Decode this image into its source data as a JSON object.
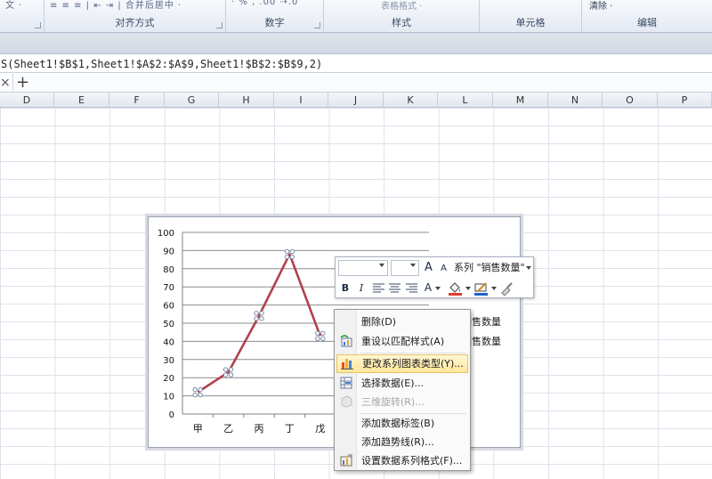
{
  "ribbon": {
    "groups": [
      {
        "label": "对齐方式"
      },
      {
        "label": "数字"
      },
      {
        "label": "样式",
        "sub": "表格格式 ·"
      },
      {
        "label": "单元格"
      },
      {
        "label": "编辑",
        "sub": "清除 ·"
      }
    ],
    "left_glyph": "文 ·",
    "align_glyphs": "≡ ≡ ≡ | ⇤ ⇥ | 合并后居中 ·",
    "number_glyphs": "· % ,  .00 ⇢.0"
  },
  "formula": {
    "text": "S(Sheet1!$B$1,Sheet1!$A$2:$A$9,Sheet1!$B$2:$B$9,2)"
  },
  "tabs": {
    "close_glyph": "×",
    "add_glyph": "+"
  },
  "columns": [
    "D",
    "E",
    "F",
    "G",
    "H",
    "I",
    "J",
    "K",
    "L",
    "M",
    "N",
    "O",
    "P"
  ],
  "colors": {
    "series_line": "#b0414a",
    "marker": "#7a8aa8",
    "highlight": "#ffe79a"
  },
  "chart_data": {
    "type": "line",
    "categories": [
      "甲",
      "乙",
      "丙",
      "丁",
      "戊"
    ],
    "series": [
      {
        "name": "销售数量",
        "values": [
          12,
          23,
          54,
          88,
          43
        ]
      }
    ],
    "ylim": [
      0,
      100
    ],
    "yticks": [
      0,
      10,
      20,
      30,
      40,
      50,
      60,
      70,
      80,
      90,
      100
    ],
    "grid": true,
    "legend_fragments": [
      "销售数量",
      "销售数量"
    ]
  },
  "mini_toolbar": {
    "grow_font": "A",
    "shrink_font": "A",
    "series_label": "系列 \"销售数量\"",
    "bold": "B",
    "italic": "I",
    "font_color": "A"
  },
  "context_menu": {
    "items": [
      {
        "label": "删除(D)",
        "icon": "none-icon"
      },
      {
        "label": "重设以匹配样式(A)",
        "icon": "reset-style-icon"
      },
      {
        "label": "更改系列图表类型(Y)...",
        "icon": "chart-type-icon",
        "highlighted": true
      },
      {
        "label": "选择数据(E)...",
        "icon": "select-data-icon"
      },
      {
        "label": "三维旋转(R)...",
        "icon": "rotate-3d-icon",
        "disabled": true
      },
      {
        "label": "添加数据标签(B)",
        "icon": "none-icon"
      },
      {
        "label": "添加趋势线(R)...",
        "icon": "none-icon"
      },
      {
        "label": "设置数据系列格式(F)...",
        "icon": "format-series-icon"
      }
    ]
  }
}
